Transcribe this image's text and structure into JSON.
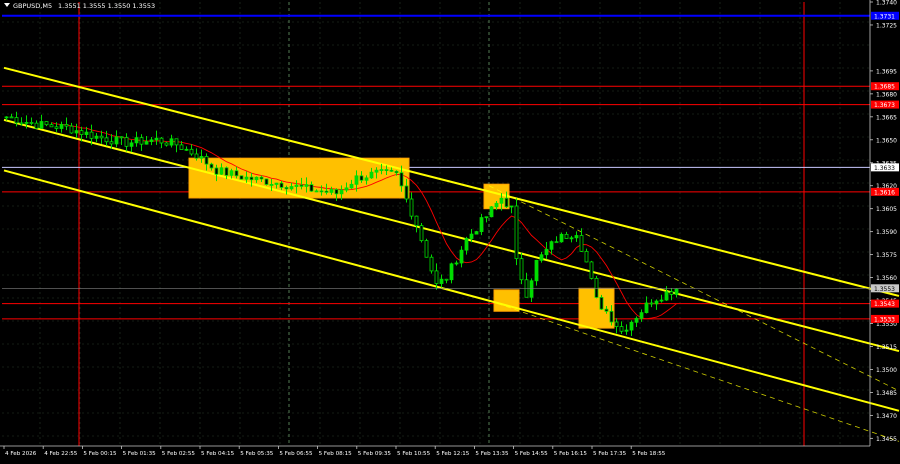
{
  "window": {
    "symbol_label": "GBPUSD,M5",
    "ohlc": "1.3551 1.3555 1.3550 1.3553"
  },
  "colors": {
    "background": "#000000",
    "grid": "#2a3a2a",
    "candle": "#00dd00",
    "channel": "#ffff00",
    "level": "#ff0000",
    "blue_level": "#0000ff",
    "white_level": "#c8c8ff",
    "zone": "#ffc000",
    "ma": "#ff0000",
    "price_badge": "#ff0000",
    "current_badge": "#c8c8c8"
  },
  "chart_data": {
    "type": "candlestick",
    "ylim": [
      1.345,
      1.374
    ],
    "price_ticks": [
      "1.3740",
      "1.3725",
      "1.3695",
      "1.3680",
      "1.3665",
      "1.3650",
      "1.3635",
      "1.3620",
      "1.3605",
      "1.3590",
      "1.3575",
      "1.3560",
      "1.3545",
      "1.3530",
      "1.3515",
      "1.3500",
      "1.3485",
      "1.3470",
      "1.3455"
    ],
    "time_labels": [
      "4 Feb 2026",
      "4 Feb 22:55",
      "5 Feb 00:15",
      "5 Feb 01:35",
      "5 Feb 02:55",
      "5 Feb 04:15",
      "5 Feb 05:35",
      "5 Feb 06:55",
      "5 Feb 08:15",
      "5 Feb 09:35",
      "5 Feb 10:55",
      "5 Feb 12:15",
      "5 Feb 13:35",
      "5 Feb 14:55",
      "5 Feb 16:15",
      "5 Feb 17:35",
      "5 Feb 18:55"
    ],
    "horizontal_levels": [
      {
        "price": 1.3731,
        "kind": "blue",
        "label": "1.3731"
      },
      {
        "price": 1.3685,
        "kind": "level",
        "label": "1.3685"
      },
      {
        "price": 1.3673,
        "kind": "level",
        "label": "1.3673"
      },
      {
        "price": 1.3632,
        "kind": "white",
        "label": "1.3633"
      },
      {
        "price": 1.3616,
        "kind": "level",
        "label": "1.3616"
      },
      {
        "price": 1.3543,
        "kind": "level",
        "label": "1.3543"
      },
      {
        "price": 1.3533,
        "kind": "level",
        "label": "1.3533"
      }
    ],
    "current_price": {
      "price": 1.3553,
      "label": "1.3553"
    },
    "vertical_red_bars": [
      15,
      160
    ],
    "vertical_green_dashed_bars": [
      57,
      97
    ],
    "channels": {
      "solid": [
        {
          "from": [
            0,
            1.3697
          ],
          "to": [
            179,
            1.3548
          ]
        },
        {
          "from": [
            0,
            1.3663
          ],
          "to": [
            179,
            1.3512
          ]
        },
        {
          "from": [
            0,
            1.363
          ],
          "to": [
            179,
            1.3473
          ]
        }
      ],
      "dashed": [
        {
          "from": [
            97,
            1.362
          ],
          "to": [
            179,
            1.3486
          ]
        },
        {
          "from": [
            97,
            1.3545
          ],
          "to": [
            179,
            1.3453
          ]
        }
      ]
    },
    "zones": [
      {
        "from_bar": 37,
        "to_bar": 81,
        "low": 1.3612,
        "high": 1.3638
      },
      {
        "from_bar": 96,
        "to_bar": 101,
        "low": 1.3605,
        "high": 1.3621
      },
      {
        "from_bar": 98,
        "to_bar": 103,
        "low": 1.3538,
        "high": 1.3552
      },
      {
        "from_bar": 115,
        "to_bar": 122,
        "low": 1.3527,
        "high": 1.3553
      }
    ],
    "close_anchors": [
      [
        0,
        1.3665
      ],
      [
        6,
        1.366
      ],
      [
        12,
        1.3658
      ],
      [
        18,
        1.3652
      ],
      [
        24,
        1.3648
      ],
      [
        30,
        1.365
      ],
      [
        34,
        1.3647
      ],
      [
        38,
        1.364
      ],
      [
        42,
        1.363
      ],
      [
        48,
        1.3625
      ],
      [
        54,
        1.3622
      ],
      [
        60,
        1.3618
      ],
      [
        66,
        1.3615
      ],
      [
        70,
        1.3625
      ],
      [
        74,
        1.3628
      ],
      [
        78,
        1.3627
      ],
      [
        82,
        1.3595
      ],
      [
        86,
        1.3555
      ],
      [
        88,
        1.356
      ],
      [
        92,
        1.3585
      ],
      [
        96,
        1.36
      ],
      [
        99,
        1.3612
      ],
      [
        101,
        1.3605
      ],
      [
        102,
        1.357
      ],
      [
        104,
        1.355
      ],
      [
        106,
        1.357
      ],
      [
        110,
        1.3585
      ],
      [
        114,
        1.359
      ],
      [
        116,
        1.357
      ],
      [
        118,
        1.3545
      ],
      [
        120,
        1.3538
      ],
      [
        123,
        1.3525
      ],
      [
        126,
        1.3535
      ],
      [
        129,
        1.3545
      ],
      [
        132,
        1.355
      ],
      [
        134,
        1.3553
      ]
    ]
  }
}
